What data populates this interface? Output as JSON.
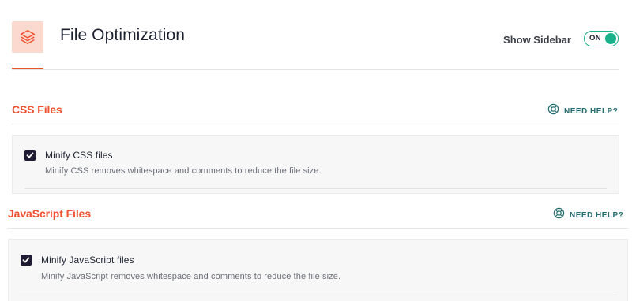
{
  "header": {
    "title": "File Optimization",
    "icon": "layers-icon",
    "show_sidebar_label": "Show Sidebar",
    "toggle_state": "ON"
  },
  "sections": [
    {
      "title": "CSS Files",
      "help_label": "NEED HELP?",
      "options": [
        {
          "label": "Minify CSS files",
          "description": "Minify CSS removes whitespace and comments to reduce the file size.",
          "checked": true
        }
      ]
    },
    {
      "title": "JavaScript Files",
      "help_label": "NEED HELP?",
      "options": [
        {
          "label": "Minify JavaScript files",
          "description": "Minify JavaScript removes whitespace and comments to reduce the file size.",
          "checked": true
        }
      ]
    }
  ],
  "colors": {
    "accent": "#f0502d",
    "icon_bg": "#fcd9cf",
    "toggle_on": "#19b18a",
    "help_link": "#236c70",
    "checkbox": "#1f1b33"
  }
}
